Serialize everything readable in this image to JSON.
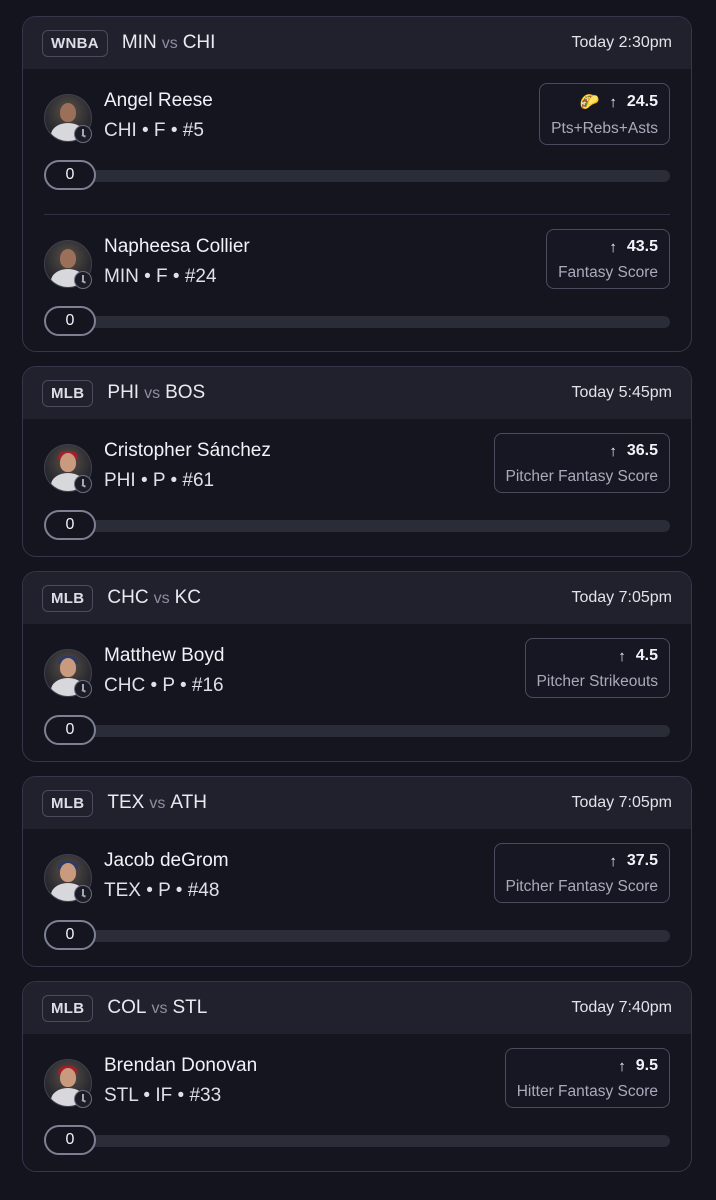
{
  "games": [
    {
      "league": "WNBA",
      "home": "MIN",
      "vs": "vs",
      "away": "CHI",
      "time": "Today 2:30pm",
      "players": [
        {
          "name": "Angel Reese",
          "meta": "CHI • F • #5",
          "line": "24.5",
          "stat": "Pts+Rebs+Asts",
          "direction_icon": "arrow-up-icon",
          "badge_icon": "taco-icon",
          "badge_glyph": "🌮",
          "progress_label": "0",
          "progress": 0,
          "avatar_style": "wnba"
        },
        {
          "name": "Napheesa Collier",
          "meta": "MIN • F • #24",
          "line": "43.5",
          "stat": "Fantasy Score",
          "direction_icon": "arrow-up-icon",
          "progress_label": "0",
          "progress": 0,
          "avatar_style": "wnba"
        }
      ]
    },
    {
      "league": "MLB",
      "home": "PHI",
      "vs": "vs",
      "away": "BOS",
      "time": "Today 5:45pm",
      "players": [
        {
          "name": "Cristopher Sánchez",
          "meta": "PHI • P • #61",
          "line": "36.5",
          "stat": "Pitcher Fantasy Score",
          "direction_icon": "arrow-up-icon",
          "progress_label": "0",
          "progress": 0,
          "avatar_style": "mlb-red"
        }
      ]
    },
    {
      "league": "MLB",
      "home": "CHC",
      "vs": "vs",
      "away": "KC",
      "time": "Today 7:05pm",
      "players": [
        {
          "name": "Matthew Boyd",
          "meta": "CHC • P • #16",
          "line": "4.5",
          "stat": "Pitcher Strikeouts",
          "direction_icon": "arrow-up-icon",
          "progress_label": "0",
          "progress": 0,
          "avatar_style": "mlb-blue"
        }
      ]
    },
    {
      "league": "MLB",
      "home": "TEX",
      "vs": "vs",
      "away": "ATH",
      "time": "Today 7:05pm",
      "players": [
        {
          "name": "Jacob deGrom",
          "meta": "TEX • P • #48",
          "line": "37.5",
          "stat": "Pitcher Fantasy Score",
          "direction_icon": "arrow-up-icon",
          "progress_label": "0",
          "progress": 0,
          "avatar_style": "mlb-blue"
        }
      ]
    },
    {
      "league": "MLB",
      "home": "COL",
      "vs": "vs",
      "away": "STL",
      "time": "Today 7:40pm",
      "players": [
        {
          "name": "Brendan Donovan",
          "meta": "STL • IF • #33",
          "line": "9.5",
          "stat": "Hitter Fantasy Score",
          "direction_icon": "arrow-up-icon",
          "progress_label": "0",
          "progress": 0,
          "avatar_style": "mlb-red"
        }
      ]
    }
  ],
  "arrow_glyph": "↑",
  "colors": {
    "background": "#13141d",
    "card": "#14151f",
    "header": "#20212c",
    "border": "#34364a",
    "track": "#2a2c38",
    "text": "#e6e7ee",
    "muted": "#a9abbb"
  }
}
